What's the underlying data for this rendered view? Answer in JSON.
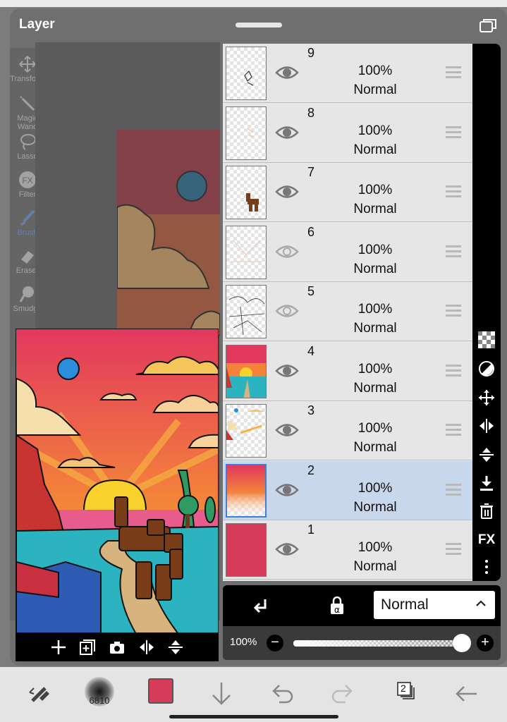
{
  "dialog": {
    "title": "Layer"
  },
  "tools": [
    {
      "label": "Transform",
      "icon": "move-icon"
    },
    {
      "label": "Magic Wand",
      "icon": "magic-wand-icon"
    },
    {
      "label": "Lasso",
      "icon": "lasso-icon"
    },
    {
      "label": "Filter",
      "icon": "fx-icon"
    },
    {
      "label": "Brush",
      "icon": "brush-icon"
    },
    {
      "label": "Eraser",
      "icon": "eraser-icon"
    },
    {
      "label": "Smudge",
      "icon": "smudge-icon"
    }
  ],
  "layers": [
    {
      "num": "9",
      "opacity": "100%",
      "blend": "Normal",
      "visible": true,
      "selected": false
    },
    {
      "num": "8",
      "opacity": "100%",
      "blend": "Normal",
      "visible": true,
      "selected": false
    },
    {
      "num": "7",
      "opacity": "100%",
      "blend": "Normal",
      "visible": true,
      "selected": false
    },
    {
      "num": "6",
      "opacity": "100%",
      "blend": "Normal",
      "visible": false,
      "selected": false
    },
    {
      "num": "5",
      "opacity": "100%",
      "blend": "Normal",
      "visible": false,
      "selected": false
    },
    {
      "num": "4",
      "opacity": "100%",
      "blend": "Normal",
      "visible": true,
      "selected": false
    },
    {
      "num": "3",
      "opacity": "100%",
      "blend": "Normal",
      "visible": true,
      "selected": false
    },
    {
      "num": "2",
      "opacity": "100%",
      "blend": "Normal",
      "visible": true,
      "selected": true
    },
    {
      "num": "1",
      "opacity": "100%",
      "blend": "Normal",
      "visible": true,
      "selected": false
    }
  ],
  "right_tools": [
    "checker-icon",
    "invert-icon",
    "move-icon",
    "flip-horizontal-icon",
    "flip-vertical-icon",
    "merge-down-icon",
    "trash-icon",
    "fx-icon",
    "more-icon"
  ],
  "right_fx_label": "FX",
  "blend_mode": {
    "value": "Normal"
  },
  "opacity": {
    "label": "100%",
    "value": 1.0
  },
  "preview_toolbar": [
    "add-layer-icon",
    "duplicate-layer-icon",
    "camera-icon",
    "flip-horizontal-icon",
    "flip-vertical-icon"
  ],
  "appbar": {
    "brush_size": "6810",
    "color": "#d63b5a",
    "layer_count": "2"
  },
  "colors": {
    "selected_layer": "#c9d7ec",
    "layer_bg": "#e6e6e6",
    "accent": "#3f7fd6"
  }
}
